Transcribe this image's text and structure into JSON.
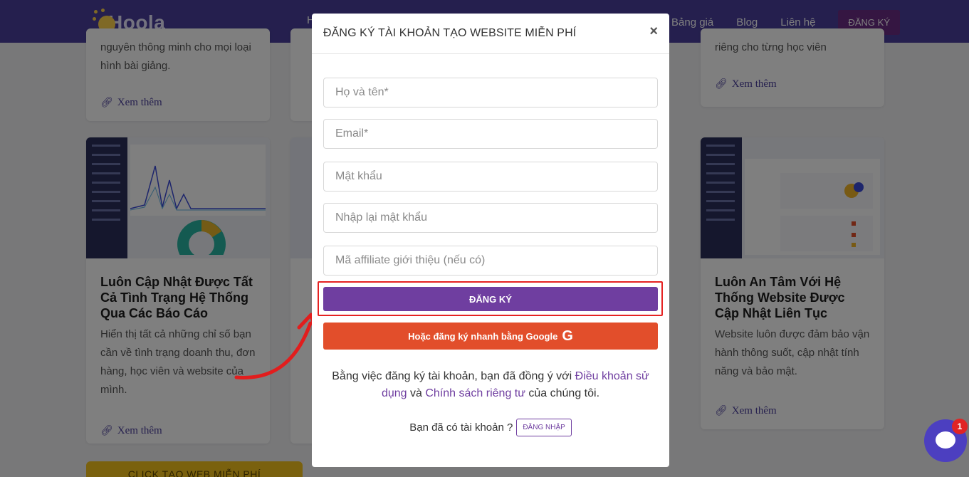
{
  "nav": {
    "logo": "Hoola",
    "stub_letter": "H",
    "links": [
      "Bảng giá",
      "Blog",
      "Liên hệ"
    ],
    "register": "ĐĂNG KÝ"
  },
  "cards_top": [
    {
      "desc": "nguyên thông minh cho mọi loại hình bài giảng.",
      "more": "Xem thêm"
    },
    {
      "desc": "",
      "more": ""
    },
    {
      "desc": "riêng cho từng học viên",
      "more": "Xem thêm"
    }
  ],
  "cards": [
    {
      "title": "Luôn Cập Nhật Được Tất Cả Tình Trạng Hệ Thống Qua Các Báo Cáo",
      "desc": "Hiển thị tất cả những chỉ số bạn cần về tình trạng doanh thu, đơn hàng, học viên và website của mình.",
      "more": "Xem thêm"
    },
    {
      "title": "Luôn An Tâm Với Hệ Thống Website Được Cập Nhật Liên Tục",
      "desc": "Website luôn được đảm bảo vận hành thông suốt, cập nhật tính năng và bảo mật.",
      "more": "Xem thêm"
    }
  ],
  "cta_button": "CLICK TẠO WEB MIỄN PHÍ",
  "modal": {
    "title": "ĐĂNG KÝ TÀI KHOẢN TẠO WEBSITE MIỄN PHÍ",
    "close": "×",
    "fields": {
      "name": "Họ và tên*",
      "email": "Email*",
      "password": "Mật khẩu",
      "password_confirm": "Nhập lại mật khẩu",
      "affiliate": "Mã affiliate giới thiệu (nếu có)"
    },
    "register_button": "ĐĂNG KÝ",
    "google_button": "Hoặc đăng ký nhanh bằng Google",
    "google_glyph": "G",
    "terms_prefix": "Bằng việc đăng ký tài khoản, bạn đã đồng ý với",
    "terms_link": "Điều khoản sử dụng",
    "terms_and": "và",
    "privacy_link": "Chính sách riêng tư",
    "terms_suffix": "của chúng tôi.",
    "have_account": "Bạn đã có tài khoản ?",
    "login_button": "ĐĂNG NHẬP"
  },
  "chat": {
    "badge": "1"
  },
  "colors": {
    "primary": "#6f3ea0",
    "google": "#e24e2b",
    "nav": "#4a3f9c",
    "highlight": "#e52222"
  }
}
